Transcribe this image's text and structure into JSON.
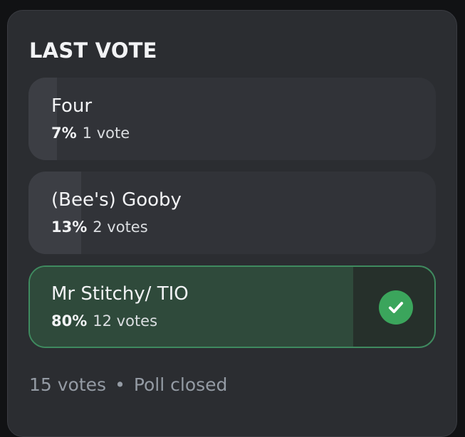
{
  "poll": {
    "title": "LAST VOTE",
    "options": [
      {
        "label": "Four",
        "percent_text": "7%",
        "votes_text": "1 vote",
        "fill_percent": 7,
        "selected": false
      },
      {
        "label": "(Bee's) Gooby",
        "percent_text": "13%",
        "votes_text": "2 votes",
        "fill_percent": 13,
        "selected": false
      },
      {
        "label": "Mr Stitchy/ TIO",
        "percent_text": "80%",
        "votes_text": "12 votes",
        "fill_percent": 80,
        "selected": true
      }
    ],
    "footer": {
      "total_votes": "15 votes",
      "separator": "•",
      "status": "Poll closed"
    }
  },
  "colors": {
    "card_background": "#2b2d31",
    "option_background": "#313338",
    "winner_border": "#3f8a5f",
    "check_green": "#3ba55c"
  },
  "icons": {
    "winner_check": "check-circle-icon"
  }
}
